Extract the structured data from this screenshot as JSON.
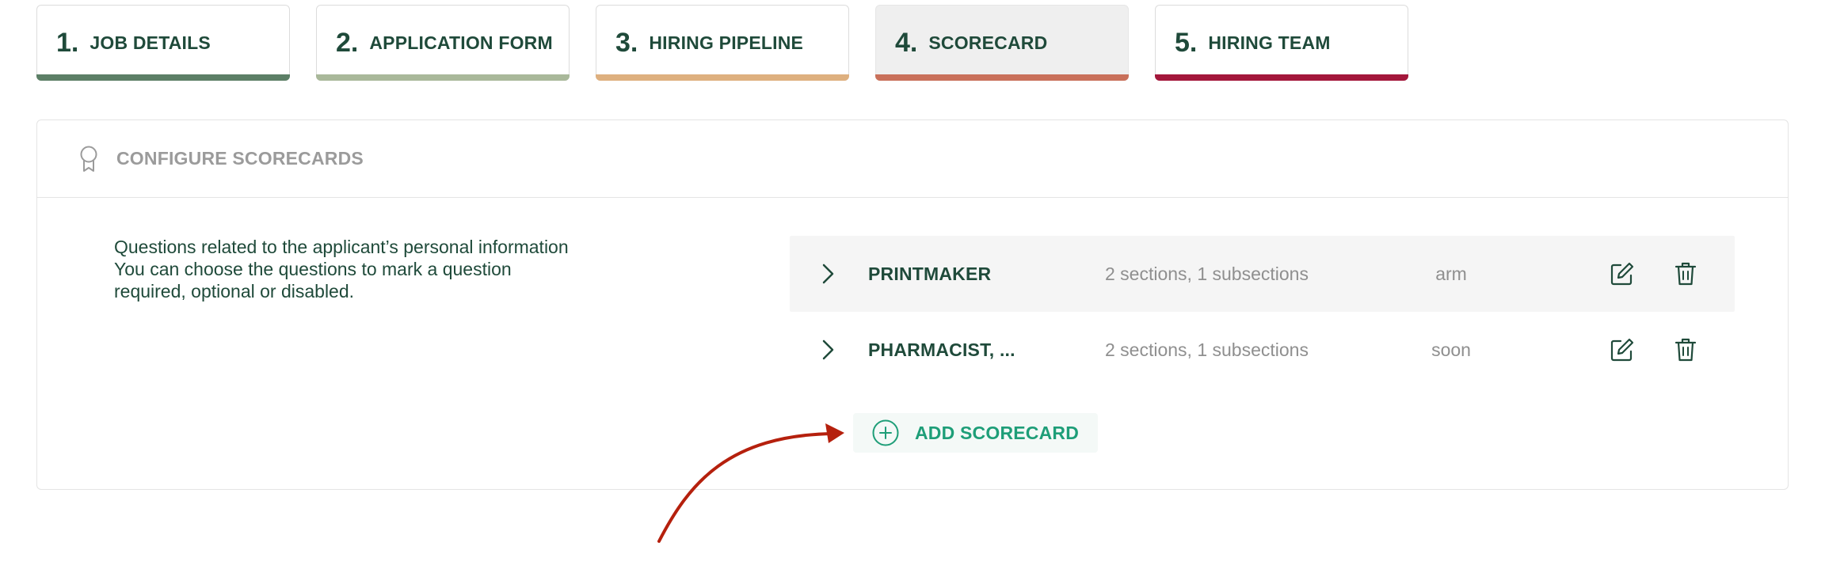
{
  "steps": [
    {
      "number": "1.",
      "label": "JOB DETAILS",
      "color": "#5c7f66",
      "active": false
    },
    {
      "number": "2.",
      "label": "APPLICATION FORM",
      "color": "#a9b89a",
      "active": false
    },
    {
      "number": "3.",
      "label": "HIRING PIPELINE",
      "color": "#deb07f",
      "active": false
    },
    {
      "number": "4.",
      "label": "SCORECARD",
      "color": "#c9705a",
      "active": true
    },
    {
      "number": "5.",
      "label": "HIRING TEAM",
      "color": "#a3173b",
      "active": false
    }
  ],
  "section": {
    "title": "CONFIGURE SCORECARDS",
    "icon": "award-ribbon-icon",
    "description": "Questions related to the applicant’s personal information You can choose the questions to mark a question required, optional or disabled."
  },
  "scorecards": [
    {
      "name": "PRINTMAKER",
      "meta": "2 sections, 1 subsections",
      "owner": "arm"
    },
    {
      "name": "PHARMACIST, ...",
      "meta": "2 sections, 1 subsections",
      "owner": "soon"
    }
  ],
  "add_button": {
    "label": "ADD SCORECARD",
    "icon": "plus-circle-icon"
  },
  "colors": {
    "accent": "#1e9e78",
    "text": "#1f4a3a",
    "muted": "#8f8f8f",
    "annotation_arrow": "#b5200d"
  }
}
